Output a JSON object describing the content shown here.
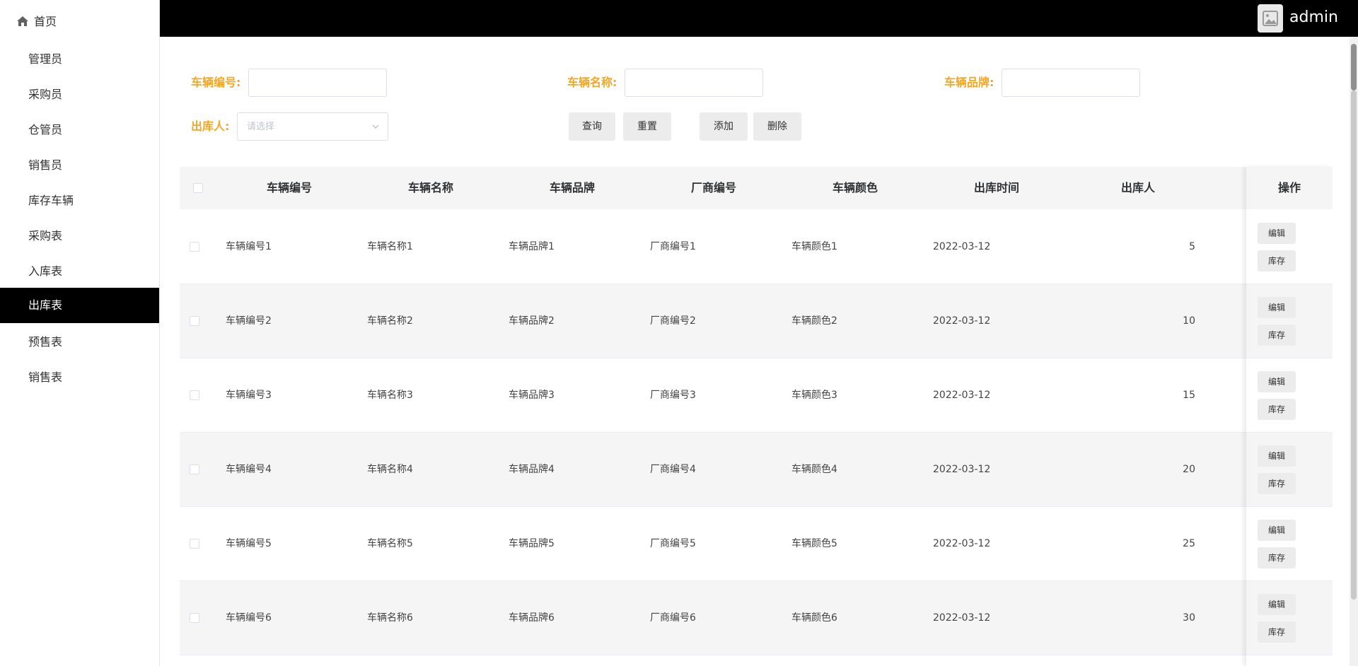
{
  "sidebar": {
    "home_label": "首页",
    "items": [
      {
        "label": "管理员"
      },
      {
        "label": "采购员"
      },
      {
        "label": "仓管员"
      },
      {
        "label": "销售员"
      },
      {
        "label": "库存车辆"
      },
      {
        "label": "采购表"
      },
      {
        "label": "入库表"
      },
      {
        "label": "出库表",
        "active": true
      },
      {
        "label": "预售表"
      },
      {
        "label": "销售表"
      }
    ]
  },
  "header": {
    "username": "admin"
  },
  "search": {
    "vehicle_no_label": "车辆编号:",
    "vehicle_no_value": "",
    "vehicle_name_label": "车辆名称:",
    "vehicle_name_value": "",
    "vehicle_brand_label": "车辆品牌:",
    "vehicle_brand_value": "",
    "outbound_person_label": "出库人:",
    "outbound_person_placeholder": "请选择",
    "query_label": "查询",
    "reset_label": "重置",
    "add_label": "添加",
    "delete_label": "删除"
  },
  "table": {
    "columns": [
      "车辆编号",
      "车辆名称",
      "车辆品牌",
      "厂商编号",
      "车辆颜色",
      "出库时间",
      "出库人",
      "操作"
    ],
    "edit_label": "编辑",
    "stock_label": "库存",
    "rows": [
      {
        "no": "车辆编号1",
        "name": "车辆名称1",
        "brand": "车辆品牌1",
        "maker": "厂商编号1",
        "color": "车辆颜色1",
        "time": "2022-03-12",
        "person": "5"
      },
      {
        "no": "车辆编号2",
        "name": "车辆名称2",
        "brand": "车辆品牌2",
        "maker": "厂商编号2",
        "color": "车辆颜色2",
        "time": "2022-03-12",
        "person": "10"
      },
      {
        "no": "车辆编号3",
        "name": "车辆名称3",
        "brand": "车辆品牌3",
        "maker": "厂商编号3",
        "color": "车辆颜色3",
        "time": "2022-03-12",
        "person": "15"
      },
      {
        "no": "车辆编号4",
        "name": "车辆名称4",
        "brand": "车辆品牌4",
        "maker": "厂商编号4",
        "color": "车辆颜色4",
        "time": "2022-03-12",
        "person": "20"
      },
      {
        "no": "车辆编号5",
        "name": "车辆名称5",
        "brand": "车辆品牌5",
        "maker": "厂商编号5",
        "color": "车辆颜色5",
        "time": "2022-03-12",
        "person": "25"
      },
      {
        "no": "车辆编号6",
        "name": "车辆名称6",
        "brand": "车辆品牌6",
        "maker": "厂商编号6",
        "color": "车辆颜色6",
        "time": "2022-03-12",
        "person": "30"
      }
    ]
  },
  "colors": {
    "accent_label": "#f5a623",
    "header_bg": "#000000",
    "active_menu_bg": "#000000"
  }
}
